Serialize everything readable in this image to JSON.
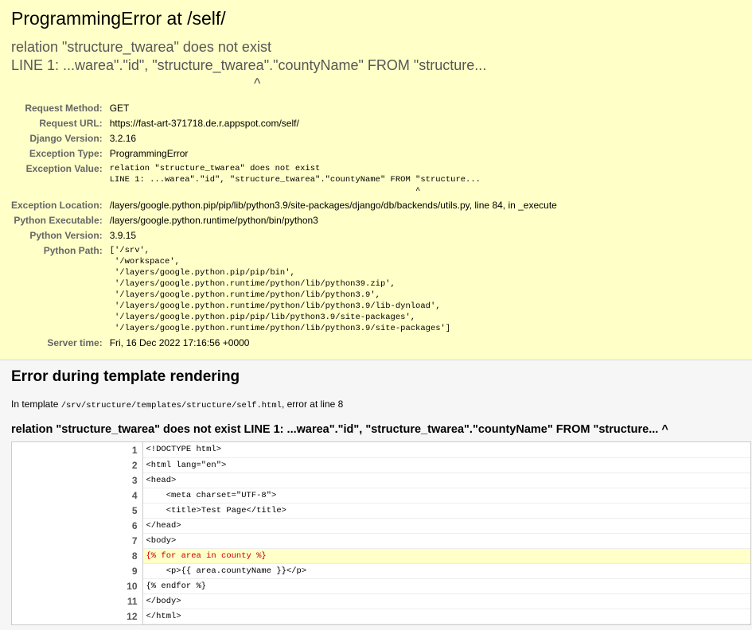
{
  "summary": {
    "title": "ProgrammingError at /self/",
    "exception_value_display": "relation \"structure_twarea\" does not exist\nLINE 1: ...warea\".\"id\", \"structure_twarea\".\"countyName\" FROM \"structure...\n                                                             ^",
    "meta": [
      {
        "label": "Request Method:",
        "value": "GET"
      },
      {
        "label": "Request URL:",
        "value": "https://fast-art-371718.de.r.appspot.com/self/"
      },
      {
        "label": "Django Version:",
        "value": "3.2.16"
      },
      {
        "label": "Exception Type:",
        "value": "ProgrammingError"
      },
      {
        "label": "Exception Value:",
        "value": "relation \"structure_twarea\" does not exist\nLINE 1: ...warea\".\"id\", \"structure_twarea\".\"countyName\" FROM \"structure...\n                                                             ^",
        "pre": true
      },
      {
        "label": "Exception Location:",
        "value": "/layers/google.python.pip/pip/lib/python3.9/site-packages/django/db/backends/utils.py, line 84, in _execute"
      },
      {
        "label": "Python Executable:",
        "value": "/layers/google.python.runtime/python/bin/python3"
      },
      {
        "label": "Python Version:",
        "value": "3.9.15"
      },
      {
        "label": "Python Path:",
        "value": "['/srv',\n '/workspace',\n '/layers/google.python.pip/pip/bin',\n '/layers/google.python.runtime/python/lib/python39.zip',\n '/layers/google.python.runtime/python/lib/python3.9',\n '/layers/google.python.runtime/python/lib/python3.9/lib-dynload',\n '/layers/google.python.pip/pip/lib/python3.9/site-packages',\n '/layers/google.python.runtime/python/lib/python3.9/site-packages']",
        "pre": true
      },
      {
        "label": "Server time:",
        "value": "Fri, 16 Dec 2022 17:16:56 +0000"
      }
    ]
  },
  "template": {
    "heading": "Error during template rendering",
    "in_template_prefix": "In template ",
    "template_path": "/srv/structure/templates/structure/self.html",
    "error_at_line": ", error at line 8",
    "error_message": "relation \"structure_twarea\" does not exist LINE 1: ...warea\".\"id\", \"structure_twarea\".\"countyName\" FROM \"structure... ^",
    "source_lines": [
      {
        "num": "1",
        "code": "<!DOCTYPE html>"
      },
      {
        "num": "2",
        "code": "<html lang=\"en\">"
      },
      {
        "num": "3",
        "code": "<head>"
      },
      {
        "num": "4",
        "code": "    <meta charset=\"UTF-8\">"
      },
      {
        "num": "5",
        "code": "    <title>Test Page</title>"
      },
      {
        "num": "6",
        "code": "</head>"
      },
      {
        "num": "7",
        "code": "<body>"
      },
      {
        "num": "8",
        "code": "{% for area in county %}",
        "error": true
      },
      {
        "num": "9",
        "code": "    <p>{{ area.countyName }}</p>"
      },
      {
        "num": "10",
        "code": "{% endfor %}"
      },
      {
        "num": "11",
        "code": "</body>"
      },
      {
        "num": "12",
        "code": "</html>"
      }
    ]
  }
}
